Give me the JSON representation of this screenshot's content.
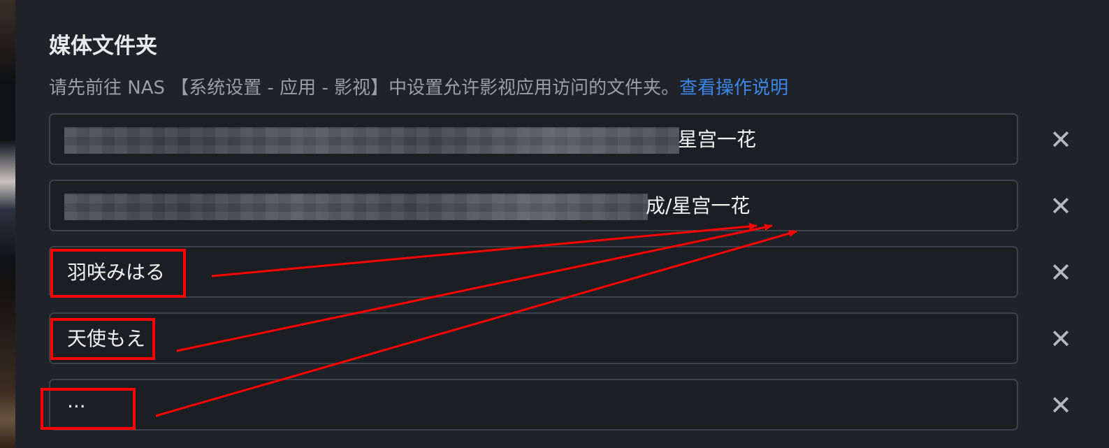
{
  "section": {
    "title": "媒体文件夹",
    "description": "请先前往 NAS 【系统设置 - 应用 - 影视】中设置允许影视应用访问的文件夹。",
    "help_link": "查看操作说明"
  },
  "folders": [
    {
      "text": "星宫一花",
      "remove_icon": "✕"
    },
    {
      "text": "成/星宫一花",
      "remove_icon": "✕"
    },
    {
      "text": "羽咲みはる",
      "remove_icon": "✕"
    },
    {
      "text": "天使もえ",
      "remove_icon": "✕"
    },
    {
      "text": "...",
      "remove_icon": "✕"
    }
  ],
  "annotation_color": "#ff0000"
}
